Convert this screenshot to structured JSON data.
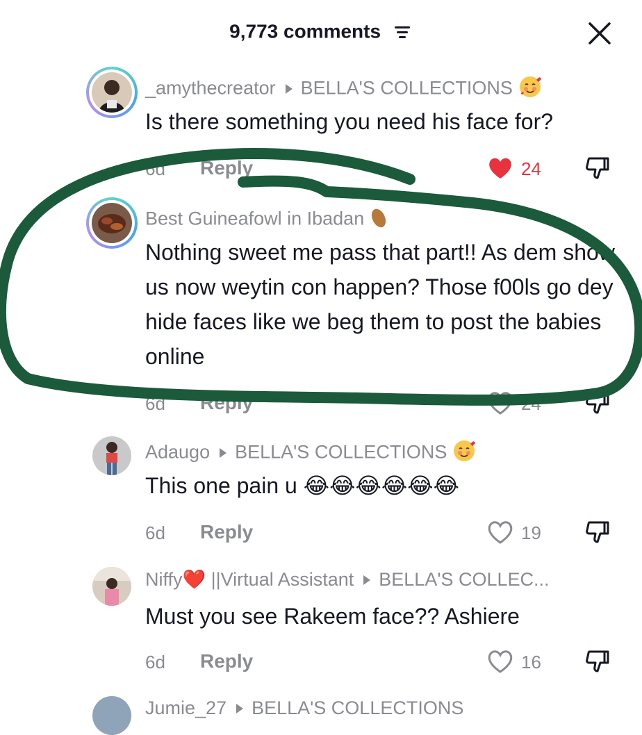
{
  "header": {
    "title": "9,773 comments",
    "close_icon": "close-icon",
    "filter_icon": "filter-icon"
  },
  "colors": {
    "accent_like": "#e8333f",
    "meta_text": "#8a8b91",
    "annotation_stroke": "#1b5a3a"
  },
  "comments": [
    {
      "username": "_amythecreator",
      "reply_to": "BELLA'S COLLECTIONS",
      "text": "Is there something you need his face for?",
      "date": "6d",
      "reply_label": "Reply",
      "likes": "24",
      "liked": true
    },
    {
      "username": "Best Guineafowl in Ibadan",
      "reply_to": "",
      "text": "Nothing sweet me pass that part!! As dem show us now weytin con happen? Those f00ls go dey hide faces like we beg them to post the babies online",
      "date": "6d",
      "reply_label": "Reply",
      "likes": "24",
      "liked": false
    },
    {
      "username": "Adaugo",
      "reply_to": "BELLA'S COLLECTIONS",
      "text": "This one pain u 😂😂😂😂😂😂",
      "date": "6d",
      "reply_label": "Reply",
      "likes": "19",
      "liked": false
    },
    {
      "username": "Niffy❤️ ||Virtual Assistant",
      "reply_to": "BELLA'S COLLEC...",
      "text": "Must you see Rakeem face?? Ashiere",
      "date": "6d",
      "reply_label": "Reply",
      "likes": "16",
      "liked": false
    },
    {
      "username": "Jumie_27",
      "reply_to": "BELLA'S COLLECTIONS",
      "text": "",
      "date": "",
      "reply_label": "",
      "likes": "",
      "liked": false
    }
  ]
}
